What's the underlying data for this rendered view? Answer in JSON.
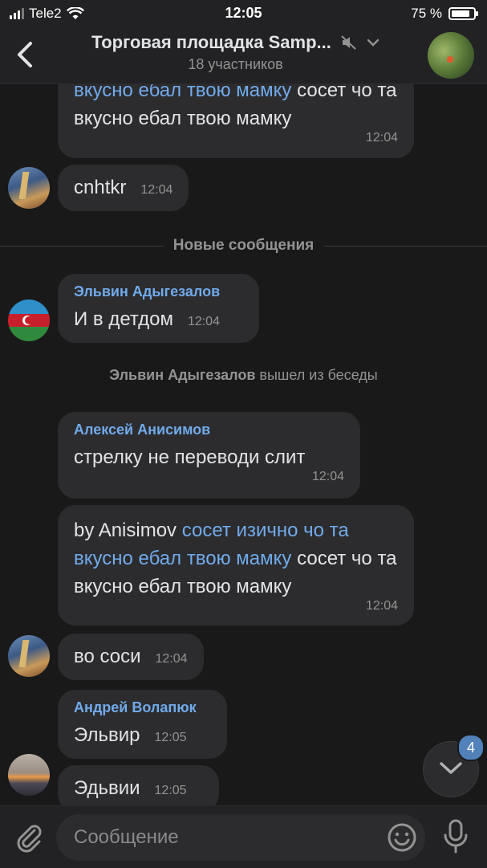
{
  "status_bar": {
    "carrier": "Tele2",
    "time": "12:05",
    "battery": "75 %"
  },
  "header": {
    "title": "Торговая площадка Samp...",
    "subtitle": "18 участников"
  },
  "messages": {
    "m1": {
      "text_link": "вкусно ебал твою мамку",
      "text_after": " сосет чо та вкусно ебал твою мамку",
      "time": "12:04"
    },
    "m2": {
      "text": "cnhtkr",
      "time": "12:04"
    },
    "divider": "Новые сообщения",
    "m3": {
      "sender": "Эльвин Адыгезалов",
      "text": "И в детдом",
      "time": "12:04"
    },
    "service": {
      "name": "Эльвин Адыгезалов",
      "action": " вышел из беседы"
    },
    "m4": {
      "sender": "Алексей Анисимов",
      "text": "стрелку не переводи слит",
      "time": "12:04"
    },
    "m5": {
      "text_before": "by Anisimov ",
      "text_link": "сосет изично чо та вкусно ебал твою мамку",
      "text_after": " сосет чо та вкусно ебал твою мамку",
      "time": "12:04"
    },
    "m6": {
      "text": "во соси",
      "time": "12:04"
    },
    "m7": {
      "sender": "Андрей Волапюк",
      "text": "Эльвир",
      "time": "12:05"
    },
    "m8": {
      "text": "Эдьвии",
      "time": "12:05"
    }
  },
  "scroll_button": {
    "unread_count": "4"
  },
  "composer": {
    "placeholder": "Сообщение"
  },
  "colors": {
    "background": "#19191a",
    "bubble": "#2c2c2e",
    "accent": "#71aaeb",
    "badge": "#5181b8"
  }
}
